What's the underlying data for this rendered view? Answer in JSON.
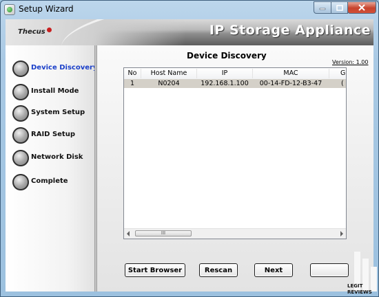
{
  "window": {
    "title": "Setup Wizard"
  },
  "banner": {
    "logo": "Thecus",
    "title": "IP Storage Appliance"
  },
  "nav": [
    {
      "label": "Device Discovery",
      "active": true
    },
    {
      "label": "Install Mode",
      "active": false
    },
    {
      "label": "System Setup",
      "active": false
    },
    {
      "label": "RAID Setup",
      "active": false
    },
    {
      "label": "Network Disk",
      "active": false
    },
    {
      "label": "Complete",
      "active": false
    }
  ],
  "main": {
    "title": "Device Discovery",
    "version": "Version: 1.00",
    "columns": [
      "No",
      "Host Name",
      "IP",
      "MAC",
      "G"
    ],
    "rows": [
      [
        "1",
        "N0204",
        "192.168.1.100",
        "00-14-FD-12-B3-47",
        "("
      ]
    ],
    "scroll_thumb": "III"
  },
  "buttons": {
    "start_browser": "Start Browser",
    "rescan": "Rescan",
    "next": "Next",
    "exit": ""
  },
  "watermark": {
    "line1": "LEGIT",
    "line2": "REVIEWS"
  },
  "colors": {
    "active_nav": "#1a3fc9",
    "selected_row": "#d4d0c8"
  },
  "icons": {
    "minimize": "minimize-icon",
    "maximize": "maximize-icon",
    "close": "close-icon"
  }
}
